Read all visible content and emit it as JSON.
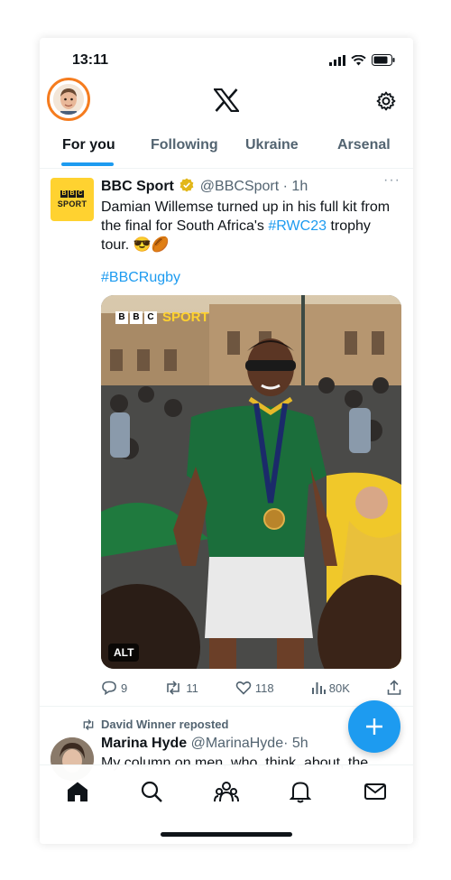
{
  "status_bar": {
    "time": "13:11"
  },
  "header": {
    "logo": "x-logo-icon",
    "settings_icon": "gear-icon"
  },
  "tabs": [
    {
      "label": "For you",
      "active": true
    },
    {
      "label": "Following",
      "active": false
    },
    {
      "label": "Ukraine",
      "active": false
    },
    {
      "label": "Arsenal",
      "active": false
    }
  ],
  "tweet": {
    "author": "BBC Sport",
    "handle": "@BBCSport",
    "time": "· 1h",
    "verified_color": "#e2b719",
    "text_1": "Damian Willemse turned up in his full kit from the final for South Africa's ",
    "text_link": "#RWC23",
    "text_2": " trophy tour. 😎🏉",
    "hashtag": "#BBCRugby",
    "media": {
      "watermark": "SPORT",
      "alt_badge": "ALT"
    },
    "actions": {
      "replies": "9",
      "reposts": "11",
      "likes": "118",
      "views": "80K"
    }
  },
  "tweet2": {
    "reposted_by": "David Winner reposted",
    "author": "Marina Hyde",
    "handle": "@MarinaHyde",
    "time": "· 5h",
    "text": "My column on men, who, think, about, the"
  },
  "colors": {
    "accent": "#1d9bf0",
    "avatar_ring": "#f57c1f",
    "bbc_yellow": "#ffd230"
  }
}
